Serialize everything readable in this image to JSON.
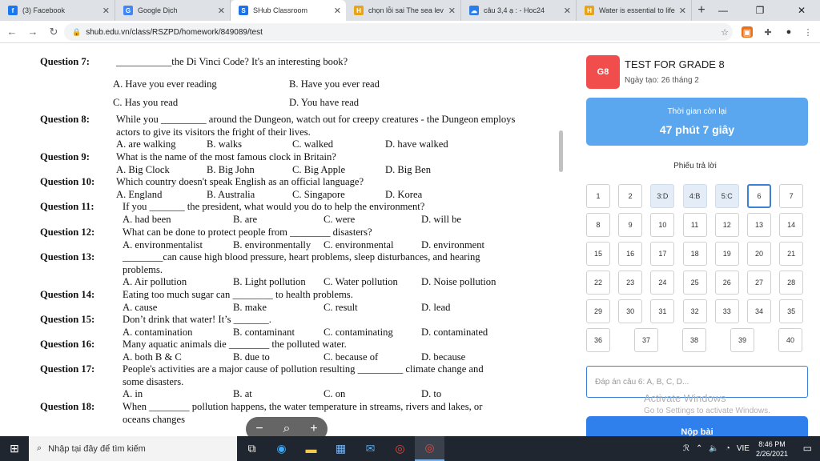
{
  "tabs": [
    {
      "title": "(3) Facebook",
      "color": "#1877f2",
      "glyph": "f"
    },
    {
      "title": "Google Dịch",
      "color": "#4285f4",
      "glyph": "G"
    },
    {
      "title": "SHub Classroom",
      "color": "#1a73e8",
      "glyph": "S"
    },
    {
      "title": "chọn lỗi sai The sea lev",
      "color": "#e8a417",
      "glyph": "H"
    },
    {
      "title": "câu 3,4 ạ : - Hoc24",
      "color": "#2b7de9",
      "glyph": "☁"
    },
    {
      "title": "Water is essential to life",
      "color": "#e8a417",
      "glyph": "H"
    }
  ],
  "url": "shub.edu.vn/class/RSZPD/homework/849089/test",
  "questions": [
    {
      "label": "Question 7:",
      "lines": [
        "___________the Di Vinci Code? It's an interesting book?"
      ],
      "options": [
        [
          "A. Have you ever reading",
          "B. Have you ever read"
        ],
        [
          "C. Has you read",
          "D. You have read"
        ]
      ]
    },
    {
      "label": "Question 8:",
      "lines": [
        "While you _________ around the Dungeon, watch out for creepy creatures - the Dungeon employs",
        "actors to give its visitors the fright of their lives."
      ],
      "options": [
        [
          "A. are walking",
          "B. walks",
          "C. walked",
          "D. have walked"
        ]
      ]
    },
    {
      "label": "Question 9:",
      "lines": [
        "What is the name of the most famous clock in Britain?"
      ],
      "options": [
        [
          "A. Big Clock",
          "B. Big John",
          "C. Big Apple",
          "D. Big Ben"
        ]
      ]
    },
    {
      "label": "Question 10:",
      "lines": [
        "Which country doesn't speak English as an official language?"
      ],
      "options": [
        [
          "A. England",
          "B. Australia",
          "C. Singapore",
          "D. Korea"
        ]
      ]
    },
    {
      "label": "Question 11:",
      "lines": [
        "If you _______ the president, what would you do to help the environment?"
      ],
      "options": [
        [
          "A. had been",
          "B. are",
          "C. were",
          "D. will be"
        ]
      ]
    },
    {
      "label": "Question 12:",
      "lines": [
        "What can be done to protect people from ________ disasters?"
      ],
      "options": [
        [
          "A. environmentalist",
          "B. environmentally",
          "C. environmental",
          "D. environment"
        ]
      ]
    },
    {
      "label": "Question 13:",
      "lines": [
        "________can cause high blood pressure, heart problems, sleep disturbances, and hearing",
        "problems."
      ],
      "options": [
        [
          "A. Air pollution",
          "B. Light pollution",
          "C. Water pollution",
          "D. Noise pollution"
        ]
      ]
    },
    {
      "label": "Question 14:",
      "lines": [
        "Eating too much sugar can ________ to health problems."
      ],
      "options": [
        [
          "A. cause",
          "B. make",
          "C. result",
          "D. lead"
        ]
      ]
    },
    {
      "label": "Question 15:",
      "lines": [
        "Don’t drink that water! It’s _______."
      ],
      "options": [
        [
          "A. contamination",
          "B. contaminant",
          "C. contaminating",
          "D. contaminated"
        ]
      ]
    },
    {
      "label": "Question 16:",
      "lines": [
        "Many aquatic animals die ________ the polluted water."
      ],
      "options": [
        [
          "A. both B & C",
          "B. due to",
          "C. because of",
          "D. because"
        ]
      ]
    },
    {
      "label": "Question 17:",
      "lines": [
        "People's activities are a major cause of pollution resulting _________ climate change and",
        "some disasters."
      ],
      "options": [
        [
          "A. in",
          "B. at",
          "C. on",
          "D. to"
        ]
      ]
    },
    {
      "label": "Question 18:",
      "lines": [
        "When ________ pollution happens, the water temperature in streams, rivers and lakes, or",
        "oceans changes"
      ],
      "options": []
    }
  ],
  "panel": {
    "badge": "G8",
    "title": "TEST FOR GRADE 8",
    "date": "Ngày tạo: 26 tháng 2",
    "timer_label": "Thời gian còn lại",
    "timer_value": "47 phút 7 giây",
    "sheet_title": "Phiếu trả lời",
    "answer_placeholder": "Đáp án câu 6: A, B, C, D...",
    "submit_label": "Nộp bài",
    "cells": [
      "1",
      "2",
      "3:D",
      "4:B",
      "5:C",
      "6",
      "7",
      "8",
      "9",
      "10",
      "11",
      "12",
      "13",
      "14",
      "15",
      "16",
      "17",
      "18",
      "19",
      "20",
      "21",
      "22",
      "23",
      "24",
      "25",
      "26",
      "27",
      "28",
      "29",
      "30",
      "31",
      "32",
      "33",
      "34",
      "35",
      "36",
      "37",
      "38",
      "39",
      "40"
    ],
    "answered": [
      2,
      3,
      4
    ],
    "current": 5
  },
  "watermark": {
    "line1": "Activate Windows",
    "line2": "Go to Settings to activate Windows."
  },
  "taskbar": {
    "search_placeholder": "Nhập tại đây để tìm kiếm",
    "lang": "VIE",
    "time": "8:46 PM",
    "date": "2/26/2021"
  }
}
